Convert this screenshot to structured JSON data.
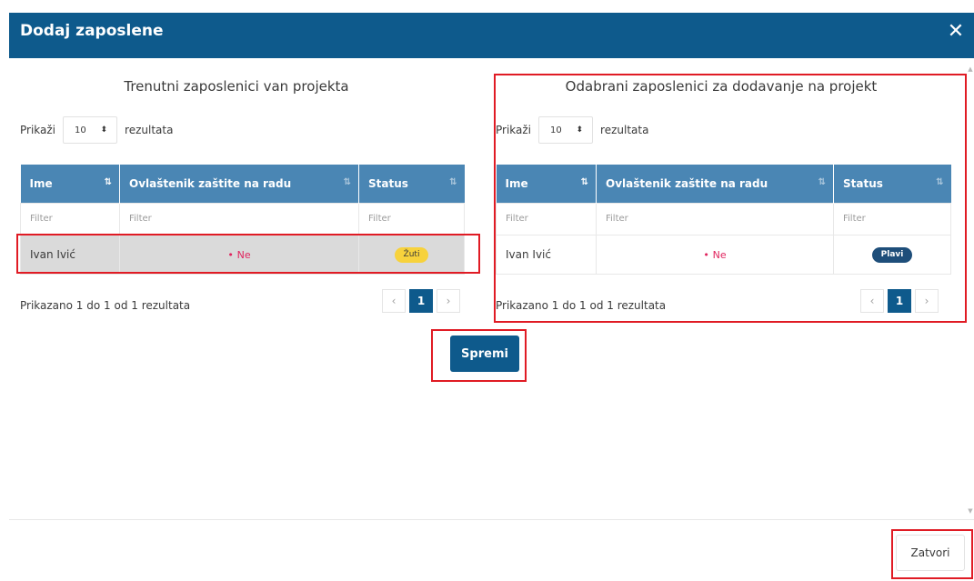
{
  "modal": {
    "title": "Dodaj zaposlene",
    "close_icon": "close-icon",
    "close_symbol": "✕"
  },
  "left_panel": {
    "title": "Trenutni zaposlenici van projekta",
    "length": {
      "prefix": "Prikaži",
      "value": "10",
      "suffix": "rezultata"
    },
    "columns": [
      "Ime",
      "Ovlaštenik zaštite na radu",
      "Status"
    ],
    "filter_placeholder": "Filter",
    "rows": [
      {
        "name": "Ivan Ivić",
        "authorized": "Ne",
        "status": "Žuti"
      }
    ],
    "info": "Prikazano 1 do 1 od 1 rezultata",
    "pager": {
      "prev": "‹",
      "current": "1",
      "next": "›"
    }
  },
  "right_panel": {
    "title": "Odabrani zaposlenici za dodavanje na projekt",
    "length": {
      "prefix": "Prikaži",
      "value": "10",
      "suffix": "rezultata"
    },
    "columns": [
      "Ime",
      "Ovlaštenik zaštite na radu",
      "Status"
    ],
    "filter_placeholder": "Filter",
    "rows": [
      {
        "name": "Ivan Ivić",
        "authorized": "Ne",
        "status": "Plavi"
      }
    ],
    "info": "Prikazano 1 do 1 od 1 rezultata",
    "pager": {
      "prev": "‹",
      "current": "1",
      "next": "›"
    }
  },
  "actions": {
    "save_label": "Spremi",
    "close_label": "Zatvori"
  },
  "glyphs": {
    "sort": "⇅",
    "dot": "•",
    "select_arrows": "⬍"
  },
  "colors": {
    "header_bg": "#0e5a8c",
    "table_header_bg": "#4a86b4",
    "highlight": "#e01b24",
    "badge_yellow": "#f7d23c",
    "badge_blue": "#1e4e7a",
    "negative": "#e0245e"
  }
}
